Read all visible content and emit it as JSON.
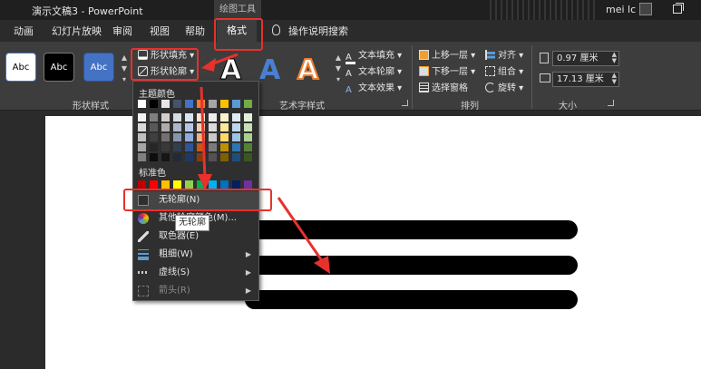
{
  "titlebar": {
    "document_title": "演示文稿3  -  PowerPoint",
    "context_tool": "绘图工具",
    "user_name": "mei lc"
  },
  "tabs": [
    {
      "label": "动画"
    },
    {
      "label": "幻灯片放映"
    },
    {
      "label": "审阅"
    },
    {
      "label": "视图"
    },
    {
      "label": "帮助"
    },
    {
      "label": "格式"
    },
    {
      "label": "操作说明搜索"
    }
  ],
  "ribbon": {
    "shape_styles": {
      "swatches": [
        "Abc",
        "Abc",
        "Abc"
      ],
      "shape_fill": "形状填充",
      "shape_outline": "形状轮廓",
      "group_label": "形状样式"
    },
    "wordart": {
      "letters": [
        "A",
        "A",
        "A"
      ],
      "text_fill": "文本填充",
      "text_outline": "文本轮廓",
      "text_effects": "文本效果",
      "group_label": "艺术字样式"
    },
    "arrange": {
      "bring_forward": "上移一层",
      "send_backward": "下移一层",
      "selection_pane": "选择窗格",
      "align": "对齐",
      "group": "组合",
      "rotate": "旋转",
      "group_label": "排列"
    },
    "size": {
      "height": "0.97 厘米",
      "width": "17.13 厘米",
      "group_label": "大小"
    }
  },
  "outline_menu": {
    "theme_colors_label": "主题颜色",
    "standard_colors_label": "标准色",
    "items": [
      {
        "label": "无轮廓(N)"
      },
      {
        "label": "其他轮廓颜色(M)..."
      },
      {
        "label": "取色器(E)"
      },
      {
        "label": "粗细(W)"
      },
      {
        "label": "虚线(S)"
      },
      {
        "label": "箭头(R)"
      }
    ],
    "tooltip": "无轮廓",
    "theme_colors_columns": [
      [
        "#ffffff",
        "#f2f2f2",
        "#d9d9d9",
        "#bfbfbf",
        "#a6a6a6",
        "#808080"
      ],
      [
        "#000000",
        "#7f7f7f",
        "#595959",
        "#404040",
        "#262626",
        "#0d0d0d"
      ],
      [
        "#e7e6e6",
        "#d0cece",
        "#aeabab",
        "#757070",
        "#3a3838",
        "#171616"
      ],
      [
        "#44546a",
        "#d6dce4",
        "#adb9ca",
        "#8497b0",
        "#333f4f",
        "#222a35"
      ],
      [
        "#4472c4",
        "#dae3f3",
        "#b4c7e7",
        "#8faadc",
        "#2f5597",
        "#203864"
      ],
      [
        "#ed7d31",
        "#fbe5d6",
        "#f8cbad",
        "#f4b183",
        "#c55a11",
        "#843c0c"
      ],
      [
        "#a5a5a5",
        "#ededed",
        "#dbdbdb",
        "#c9c9c9",
        "#7b7b7b",
        "#525252"
      ],
      [
        "#ffc000",
        "#fff2cc",
        "#ffe699",
        "#ffd966",
        "#bf9000",
        "#7f6000"
      ],
      [
        "#5b9bd5",
        "#deebf7",
        "#bdd7ee",
        "#9dc3e6",
        "#2e75b6",
        "#1f4e79"
      ],
      [
        "#70ad47",
        "#e2f0d9",
        "#c5e0b4",
        "#a9d18e",
        "#548235",
        "#385723"
      ]
    ],
    "standard_colors": [
      "#c00000",
      "#ff0000",
      "#ffc000",
      "#ffff00",
      "#92d050",
      "#00b050",
      "#00b0f0",
      "#0070c0",
      "#002060",
      "#7030a0"
    ]
  },
  "colors": {
    "accent_red": "#e8312c",
    "ribbon_bg": "#3d3d3d",
    "titlebar_bg": "#1f1f1f"
  }
}
